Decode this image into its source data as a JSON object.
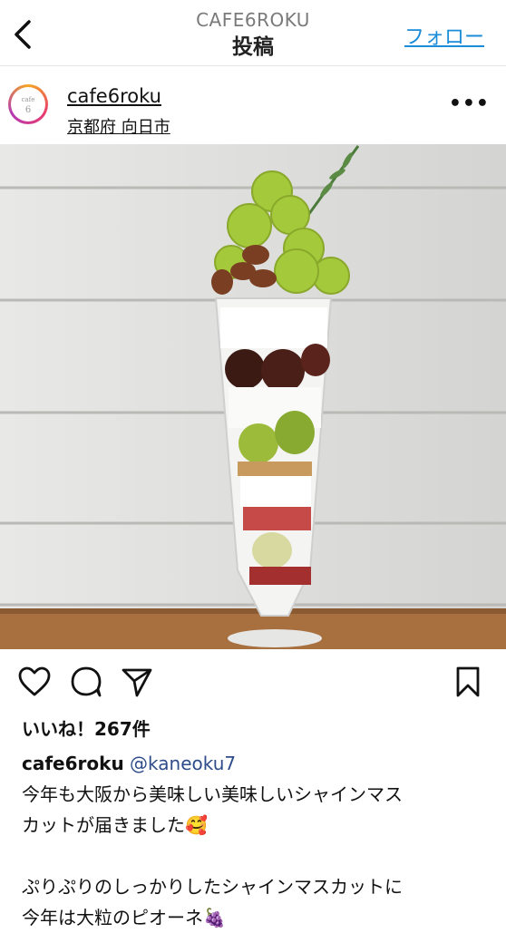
{
  "header": {
    "account": "CAFE6ROKU",
    "title": "投稿",
    "follow": "フォロー"
  },
  "post": {
    "username": "cafe6roku",
    "location": "京都府 向日市",
    "avatar_text": "cafe",
    "avatar_num": "6",
    "likes": "いいね！267件",
    "caption_user": "cafe6roku",
    "mention": "@kaneoku7",
    "caption_lines": [
      "今年も大阪から美味しい美味しいシャインマス",
      "カットが届きました🥰",
      "",
      "ぷりぷりのしっかりしたシャインマスカットに",
      "今年は大粒のピオーネ🍇"
    ]
  },
  "colors": {
    "link": "#1a8cd8",
    "mention": "#2f4c8a"
  },
  "icons": [
    "back-icon",
    "more-icon",
    "heart-icon",
    "comment-icon",
    "share-icon",
    "bookmark-icon"
  ]
}
